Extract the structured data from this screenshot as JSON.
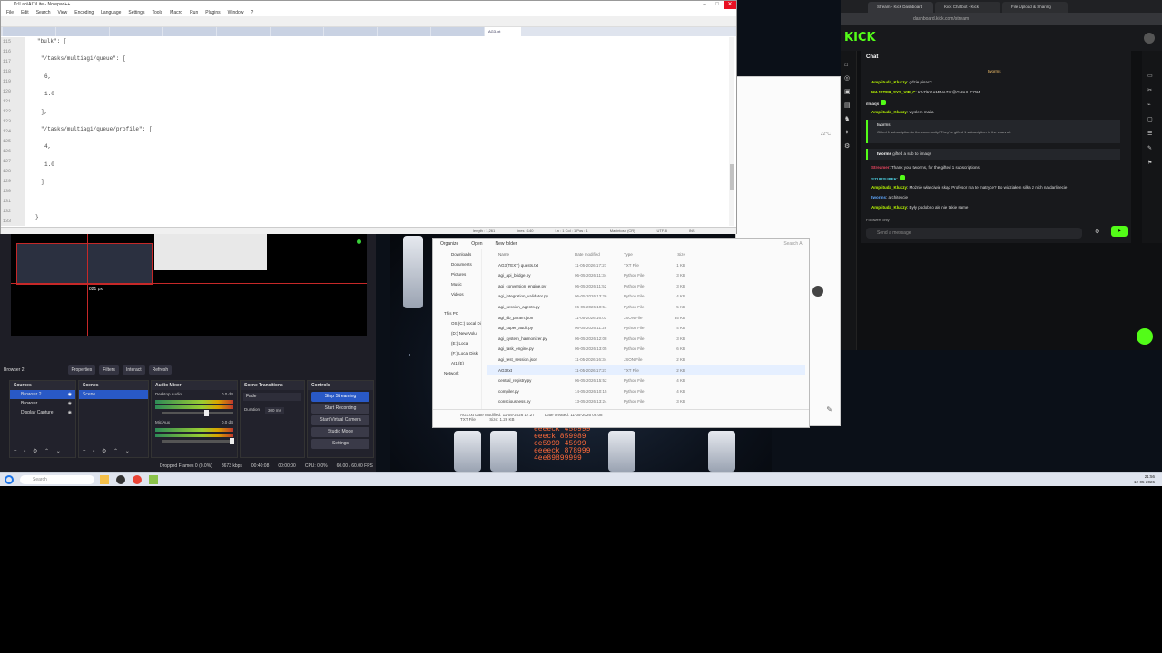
{
  "notepad": {
    "title": "D:\\Lab\\AI1\\Lite - Notepad++",
    "menu": [
      "File",
      "Edit",
      "Search",
      "View",
      "Encoding",
      "Language",
      "Settings",
      "Tools",
      "Macro",
      "Run",
      "Plugins",
      "Window",
      "?"
    ],
    "active_tab": "AG3.txt",
    "line_numbers": [
      "115",
      "116",
      "117",
      "118",
      "119",
      "120",
      "121",
      "122",
      "123",
      "124",
      "125",
      "126",
      "127",
      "128",
      "129",
      "130",
      "131",
      "132",
      "133"
    ],
    "code": {
      "l115": "\"bulk\": [",
      "l117": "\"/tasks/multiagi/queue\": [",
      "l119": "6,",
      "l121": "1.0",
      "l123": "],",
      "l125": "\"/tasks/multiagi/queue/profile\": [",
      "l127": "4,",
      "l129": "1.0",
      "l131": "]",
      "l133": "}"
    },
    "status": {
      "length": "length : 1,261",
      "lines": "lines : 140",
      "pos": "Ln : 1  Col : 1  Pos : 1",
      "eol": "Macintosh (CR)",
      "encoding": "UTF-8",
      "mode": "INS"
    }
  },
  "obs": {
    "preview_measure": "821 px",
    "source_label": "Browser 2",
    "toolbar": {
      "properties": "Properties",
      "filters": "Filters",
      "interact": "Interact",
      "refresh": "Refresh"
    },
    "sources_title": "Sources",
    "sources": [
      "Browser 2",
      "Browser",
      "Display Capture"
    ],
    "scenes_title": "Scenes",
    "scenes": [
      "Scene"
    ],
    "mixer_title": "Audio Mixer",
    "mixer": [
      {
        "name": "Desktop Audio",
        "db": "0.0 dB"
      },
      {
        "name": "Mic/Aux",
        "db": "0.0 dB"
      }
    ],
    "transitions_title": "Scene Transitions",
    "transition": "Fade",
    "duration_label": "Duration",
    "duration": "300 ms",
    "controls_title": "Controls",
    "controls": [
      "Stop Streaming",
      "Start Recording",
      "Start Virtual Camera",
      "Studio Mode",
      "Settings"
    ],
    "status": {
      "dropped": "Dropped Frames 0 (0.0%)",
      "bitrate": "8673 kbps",
      "live": "00:40:08",
      "rec": "00:00:00",
      "cpu": "CPU: 0.0%",
      "fps": "60.00 / 60.00 FPS"
    }
  },
  "explorer": {
    "toolbar": [
      "Organize",
      "Open",
      "New folder"
    ],
    "search_placeholder": "Search AI",
    "header": {
      "name": "Name",
      "date": "Date modified",
      "type": "Type",
      "size": "Size"
    },
    "nav": [
      "Downloads",
      "Documents",
      "Pictures",
      "Music",
      "Videos",
      "This PC",
      "OS (C:) Local Disk",
      "(D:) New Volu",
      "(E:) Local",
      "(F:) Local Disk",
      "AI1 (E)",
      "Network"
    ],
    "files": [
      {
        "name": "AG3(TEXT) quests.txt",
        "date": "11-05-2026 17:27",
        "type": "TXT File",
        "size": "1 KB"
      },
      {
        "name": "agi_api_bridge.py",
        "date": "06-05-2026 11:34",
        "type": "Python File",
        "size": "3 KB"
      },
      {
        "name": "agi_conversion_engine.py",
        "date": "06-05-2026 11:52",
        "type": "Python File",
        "size": "3 KB"
      },
      {
        "name": "agi_integration_validator.py",
        "date": "06-05-2026 13:26",
        "type": "Python File",
        "size": "4 KB"
      },
      {
        "name": "agi_session_agents.py",
        "date": "06-05-2026 10:54",
        "type": "Python File",
        "size": "5 KB"
      },
      {
        "name": "agi_db_param.json",
        "date": "11-05-2026 16:03",
        "type": "JSON File",
        "size": "35 KB"
      },
      {
        "name": "agi_super_audit.py",
        "date": "06-05-2026 11:28",
        "type": "Python File",
        "size": "4 KB"
      },
      {
        "name": "agi_system_harmonizer.py",
        "date": "06-05-2026 12:08",
        "type": "Python File",
        "size": "3 KB"
      },
      {
        "name": "agi_task_engine.py",
        "date": "06-05-2026 13:05",
        "type": "Python File",
        "size": "6 KB"
      },
      {
        "name": "agi_test_session.json",
        "date": "11-05-2026 16:34",
        "type": "JSON File",
        "size": "2 KB"
      },
      {
        "name": "AG3.txt",
        "date": "11-05-2026 17:27",
        "type": "TXT File",
        "size": "2 KB"
      },
      {
        "name": "central_registry.py",
        "date": "06-05-2026 15:52",
        "type": "Python File",
        "size": "4 KB"
      },
      {
        "name": "compiler.py",
        "date": "14-05-2026 10:15",
        "type": "Python File",
        "size": "4 KB"
      },
      {
        "name": "consciousness.py",
        "date": "13-05-2026 13:24",
        "type": "Python File",
        "size": "3 KB"
      }
    ],
    "details": {
      "name": "AG3.txt",
      "modified_label": "Date modified:",
      "modified": "11-05-2026 17:27",
      "created_label": "Date created:",
      "created": "11-05-2026 09:08",
      "type": "TXT File",
      "size_label": "Size:",
      "size": "1.26 KB"
    }
  },
  "background_browser": {
    "temperature": "22°C"
  },
  "kick": {
    "tabs": [
      "Stream - Kick Dashboard",
      "Kick Chatbot - Kick",
      "File Upload & Sharing"
    ],
    "url": "dashboard.kick.com/stream",
    "logo": "KICK",
    "chat_title": "Chat",
    "pinned": "tworms",
    "messages": [
      {
        "user": "Amplituda_Kluczy",
        "text": "gdzie pisac?"
      },
      {
        "user": "MAJSTER_SYS_VIP_C",
        "text": "KAZ/KGAMINAZIK@GMAIL.COM"
      },
      {
        "user": "ilmaqs",
        "text": ""
      },
      {
        "user": "Amplituda_Kluczy",
        "text": "wyslem maila"
      },
      {
        "user": "tworms",
        "text": "Gifted 1 subscription to the community! They've gifted 1 subscription in the channel."
      },
      {
        "user": "tworms",
        "text": "gifted a sub to ilmaqs"
      },
      {
        "user": "Streamer",
        "text": "Thank you, tworms, for the gifted 1 subscriptions."
      },
      {
        "user": "SZUBSUBEK",
        "text": ""
      },
      {
        "user": "Amplituda_Kluczy",
        "text": "Możnie właściwie skąd Profesor ma te matryce? Bo widziałem silka z nich na darlinecie"
      },
      {
        "user": "tworms",
        "text": "architekcie"
      },
      {
        "user": "Amplituda_Kluczy",
        "text": "Były podobno ale nie takie same"
      }
    ],
    "followers_only": "Followers only",
    "input_placeholder": "Send a message"
  },
  "taskbar": {
    "search_placeholder": "Search",
    "time": "21:56",
    "date": "12-05-2026"
  },
  "colors": {
    "kick_green": "#53fc18",
    "obs_accent": "#2959c6",
    "npp_close": "#e81123"
  }
}
